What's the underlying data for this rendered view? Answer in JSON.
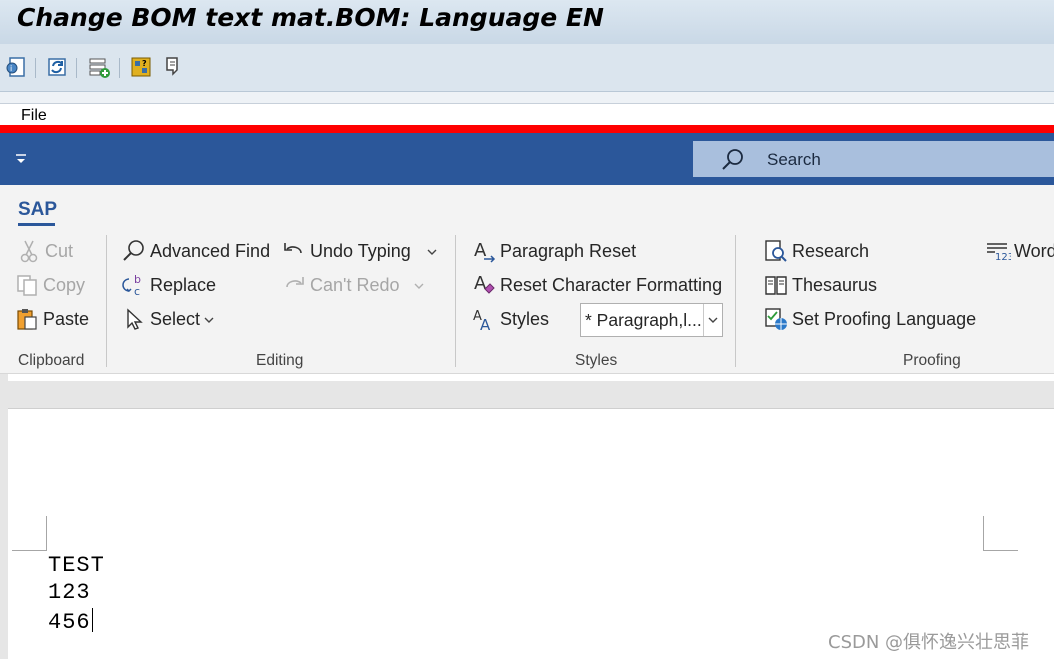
{
  "window": {
    "title": "Change BOM text mat.BOM: Language EN"
  },
  "menu": {
    "file": "File"
  },
  "search": {
    "label": "Search"
  },
  "ribbon": {
    "tab": "SAP",
    "clipboard": {
      "cut": "Cut",
      "copy": "Copy",
      "paste": "Paste",
      "label": "Clipboard"
    },
    "editing": {
      "advanced_find": "Advanced Find",
      "replace": "Replace",
      "select": "Select",
      "undo_typing": "Undo Typing",
      "cant_redo": "Can't Redo",
      "label": "Editing"
    },
    "styles": {
      "paragraph_reset": "Paragraph Reset",
      "reset_character_formatting": "Reset Character Formatting",
      "styles": "Styles",
      "selected_style": "* Paragraph,l...",
      "label": "Styles"
    },
    "proofing": {
      "research": "Research",
      "thesaurus": "Thesaurus",
      "set_proofing_language": "Set Proofing Language",
      "word_count": "Word",
      "label": "Proofing"
    }
  },
  "document": {
    "lines": [
      "TEST",
      "123",
      "456"
    ]
  },
  "watermark": "CSDN @俱怀逸兴壮思菲",
  "colors": {
    "accent": "#2b579a",
    "red_bar": "#ff0000",
    "search_bg": "#a9bfdd"
  }
}
